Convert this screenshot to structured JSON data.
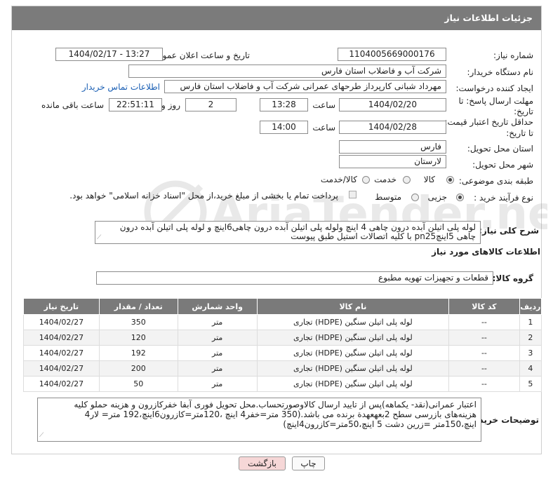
{
  "header": {
    "title": "جزئیات اطلاعات نیاز"
  },
  "need_number": {
    "label": "شماره نیاز:",
    "value": "1104005669000176"
  },
  "announce_datetime": {
    "label": "تاریخ و ساعت اعلان عمومی:",
    "value": "1404/02/17 - 13:27"
  },
  "buyer_org": {
    "label": "نام دستگاه خریدار:",
    "value": "شرکت آب و فاضلاب استان فارس"
  },
  "requester": {
    "label": "ایجاد کننده درخواست:",
    "value": "مهرداد شبانی کارپرداز طرحهای عمرانی  شرکت آب و فاضلاب استان فارس",
    "contact_link": "اطلاعات تماس خریدار"
  },
  "reply_deadline": {
    "label_line1": "مهلت ارسال پاسخ: تا",
    "label_line2": "تاریخ:",
    "date": "1404/02/20",
    "time_label": "ساعت",
    "time": "13:28",
    "days": "2",
    "days_label": "روز و",
    "remaining": "22:51:11",
    "remaining_label": "ساعت باقی مانده"
  },
  "price_validity": {
    "label_line1": "حداقل تاریخ اعتبار قیمت:",
    "label_line2": "تا تاریخ:",
    "date": "1404/02/28",
    "time_label": "ساعت",
    "time": "14:00"
  },
  "delivery_province": {
    "label": "استان محل تحویل:",
    "value": "فارس"
  },
  "delivery_city": {
    "label": "شهر محل تحویل:",
    "value": "لارستان"
  },
  "category": {
    "label": "طبقه بندی موضوعی:",
    "options": [
      "کالا",
      "خدمت",
      "کالا/خدمت"
    ],
    "selected": "کالا"
  },
  "process_type": {
    "label": "نوع فرآیند خرید :",
    "options": [
      "جزیی",
      "متوسط"
    ],
    "selected": "جزیی",
    "payment_note": "پرداخت تمام یا بخشی از مبلغ خرید،از محل \"اسناد خزانه اسلامی\" خواهد بود."
  },
  "general_description": {
    "label": "شرح کلی نیاز:",
    "value": "لوله پلی اتیلن آبده درون چاهی 4 اینچ ولوله پلی اتیلن آبده درون چاهی6اینچ و لوله پلی اتیلن آبده درون چاهی 5اینچpn25 با کلیه اتصالات استیل طبق پیوست"
  },
  "goods_info": {
    "title": "اطلاعات کالاهای مورد نیاز"
  },
  "goods_group": {
    "label": "گروه کالا:",
    "value": "قطعات و تجهیزات تهویه مطبوع"
  },
  "table": {
    "headers": [
      "ردیف",
      "کد کالا",
      "نام کالا",
      "واحد شمارش",
      "تعداد / مقدار",
      "تاریخ نیاز"
    ],
    "rows": [
      [
        "1",
        "--",
        "لوله پلی اتیلن سنگین (HDPE) تجاری",
        "متر",
        "350",
        "1404/02/27"
      ],
      [
        "2",
        "--",
        "لوله پلی اتیلن سنگین (HDPE) تجاری",
        "متر",
        "120",
        "1404/02/27"
      ],
      [
        "3",
        "--",
        "لوله پلی اتیلن سنگین (HDPE) تجاری",
        "متر",
        "192",
        "1404/02/27"
      ],
      [
        "4",
        "--",
        "لوله پلی اتیلن سنگین (HDPE) تجاری",
        "متر",
        "200",
        "1404/02/27"
      ],
      [
        "5",
        "--",
        "لوله پلی اتیلن سنگین (HDPE) تجاری",
        "متر",
        "50",
        "1404/02/27"
      ]
    ]
  },
  "buyer_notes": {
    "label": "توضیحات خریدار:",
    "value": "اعتبار عمرانی(نقد- یکماهه)پس از تایید ارسال کالاوصورتحساب.محل تحویل فوری آبفا خفرکازرون و هزینه حملو کلیه هزینه‌های بازرسی سطح 2بعهعهدة برنده می باشد.(350 متر=خفر4 اینچ ،120متر=کازرون6اینچ،192 متر= لار4 اینچ،150متر =زرین دشت 5 اینچ،50متر=کازرون4اینچ)"
  },
  "buttons": {
    "print": "چاپ",
    "back": "بازگشت"
  },
  "watermark": {
    "text": "AriaTender.net"
  },
  "colors": {
    "header_bg": "#7b7b7b",
    "link": "#1a5fb4",
    "back_button_bg": "#f6d7d7"
  }
}
